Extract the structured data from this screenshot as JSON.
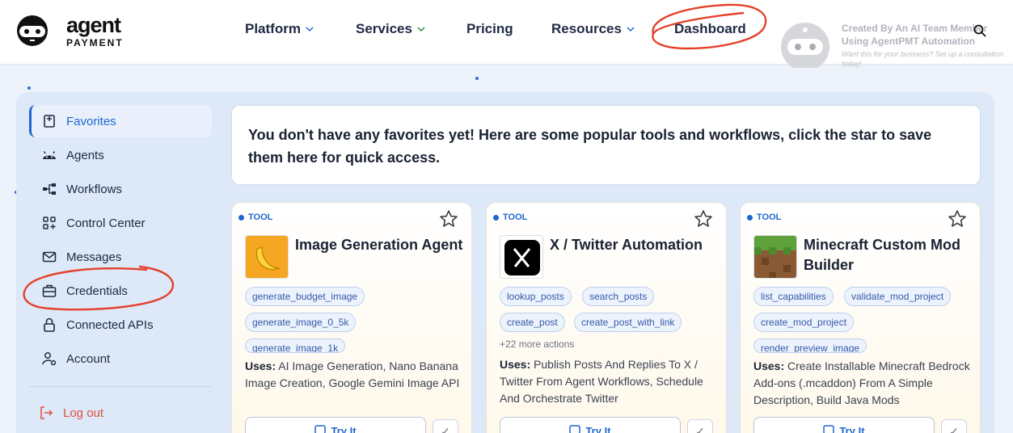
{
  "brand": {
    "word1": "agent",
    "word2": "PAYMENT"
  },
  "nav": [
    {
      "label": "Platform",
      "has_dropdown": true
    },
    {
      "label": "Services",
      "has_dropdown": true
    },
    {
      "label": "Pricing",
      "has_dropdown": false
    },
    {
      "label": "Resources",
      "has_dropdown": true
    },
    {
      "label": "Dashboard",
      "has_dropdown": false
    }
  ],
  "promo": {
    "line1": "Created By An AI Team Member",
    "line2": "Using AgentPMT Automation",
    "line3": "Want this for your business? Set up a consultation today!"
  },
  "sidebar": {
    "items": [
      {
        "label": "Favorites",
        "icon": "bookmark-icon",
        "active": true
      },
      {
        "label": "Agents",
        "icon": "android-icon"
      },
      {
        "label": "Workflows",
        "icon": "workflow-icon"
      },
      {
        "label": "Control Center",
        "icon": "grid-plus-icon"
      },
      {
        "label": "Messages",
        "icon": "mail-icon"
      },
      {
        "label": "Credentials",
        "icon": "briefcase-icon"
      },
      {
        "label": "Connected APIs",
        "icon": "lock-icon"
      },
      {
        "label": "Account",
        "icon": "user-gear-icon"
      }
    ],
    "logout": "Log out"
  },
  "notice": "You don't have any favorites yet! Here are some popular tools and workflows, click the star to save them here for quick access.",
  "cards": [
    {
      "badge": "TOOL",
      "title": "Image Generation Agent",
      "tags": [
        "generate_budget_image",
        "generate_image_0_5k",
        "generate_image_1k"
      ],
      "more": "",
      "uses_label": "Uses:",
      "uses": "AI Image Generation, Nano Banana Image Creation, Google Gemini Image API",
      "try_label": "Try It"
    },
    {
      "badge": "TOOL",
      "title": "X / Twitter Automation",
      "tags": [
        "lookup_posts",
        "search_posts",
        "create_post",
        "create_post_with_link"
      ],
      "more": "+22 more actions",
      "uses_label": "Uses:",
      "uses": "Publish Posts And Replies To X / Twitter From Agent Workflows, Schedule And Orchestrate Twitter",
      "try_label": "Try It"
    },
    {
      "badge": "TOOL",
      "title": "Minecraft Custom Mod Builder",
      "tags": [
        "list_capabilities",
        "validate_mod_project",
        "create_mod_project",
        "render_preview_image"
      ],
      "more": "",
      "uses_label": "Uses:",
      "uses": "Create Installable Minecraft Bedrock Add-ons (.mcaddon) From A Simple Description, Build Java Mods",
      "try_label": "Try It"
    }
  ],
  "colors": {
    "accent": "#1e66d0",
    "annotation": "#e5402b",
    "logout": "#e0503a"
  }
}
